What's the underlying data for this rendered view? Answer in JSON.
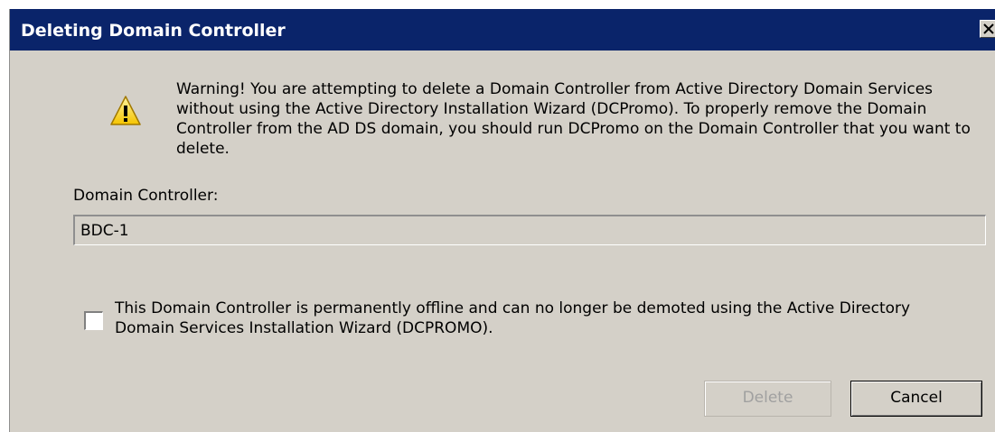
{
  "window": {
    "title": "Deleting Domain Controller",
    "close_icon": "close-icon"
  },
  "warning": {
    "icon": "warning-icon",
    "icon_color": "#f5c400",
    "text": "Warning! You are attempting to delete a Domain Controller from Active Directory Domain Services without using the Active Directory Installation Wizard (DCPromo). To properly remove the Domain Controller from the AD DS domain, you should run DCPromo on the Domain Controller that you want to delete."
  },
  "domain_controller": {
    "label": "Domain Controller:",
    "value": "BDC-1"
  },
  "offline_option": {
    "checked": false,
    "label": "This Domain Controller is permanently offline and can no longer be demoted using the Active Directory Domain Services Installation Wizard (DCPROMO)."
  },
  "buttons": {
    "delete_label": "Delete",
    "delete_enabled": false,
    "cancel_label": "Cancel"
  },
  "colors": {
    "titlebar": "#0a246a",
    "dialog_background": "#d4d0c8"
  }
}
